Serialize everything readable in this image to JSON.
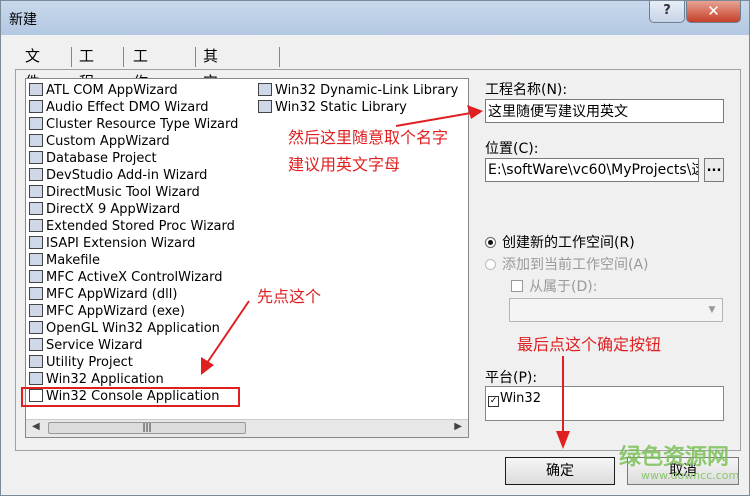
{
  "window": {
    "title": "新建",
    "help_label": "?",
    "close_label": "✕"
  },
  "tabs": [
    {
      "label": "文件"
    },
    {
      "label": "工程"
    },
    {
      "label": "工作区"
    },
    {
      "label": "其它文档"
    }
  ],
  "project_types": [
    "ATL COM AppWizard",
    "Audio Effect DMO Wizard",
    "Cluster Resource Type Wizard",
    "Custom AppWizard",
    "Database Project",
    "DevStudio Add-in Wizard",
    "DirectMusic Tool Wizard",
    "DirectX 9 AppWizard",
    "Extended Stored Proc Wizard",
    "ISAPI Extension Wizard",
    "Makefile",
    "MFC ActiveX ControlWizard",
    "MFC AppWizard (dll)",
    "MFC AppWizard (exe)",
    "OpenGL Win32 Application",
    "Service Wizard",
    "Utility Project",
    "Win32 Application",
    "Win32 Console Application"
  ],
  "project_types_col2": [
    "Win32 Dynamic-Link Library",
    "Win32 Static Library"
  ],
  "scroll_thumb": "|||",
  "form": {
    "project_name_label": "工程名称(N):",
    "project_name_value": "这里随便写建议用英文",
    "location_label": "位置(C):",
    "location_value": "E:\\softWare\\vc60\\MyProjects\\这",
    "browse_label": "...",
    "radio_new": "创建新的工作空间(R)",
    "radio_add": "添加到当前工作空间(A)",
    "dependency_label": "从属于(D):",
    "platform_label": "平台(P):",
    "platform_item": "Win32"
  },
  "buttons": {
    "ok": "确定",
    "cancel": "取消"
  },
  "annotations": {
    "name_hint_1": "然后这里随意取个名字",
    "name_hint_2": "建议用英文字母",
    "click_first": "先点这个",
    "click_ok": "最后点这个确定按钮"
  },
  "watermark": {
    "cn": "绿色资源网",
    "url": "www.downcc.com"
  },
  "colors": {
    "annotation": "#e02020",
    "watermark": "#7cc15a"
  }
}
